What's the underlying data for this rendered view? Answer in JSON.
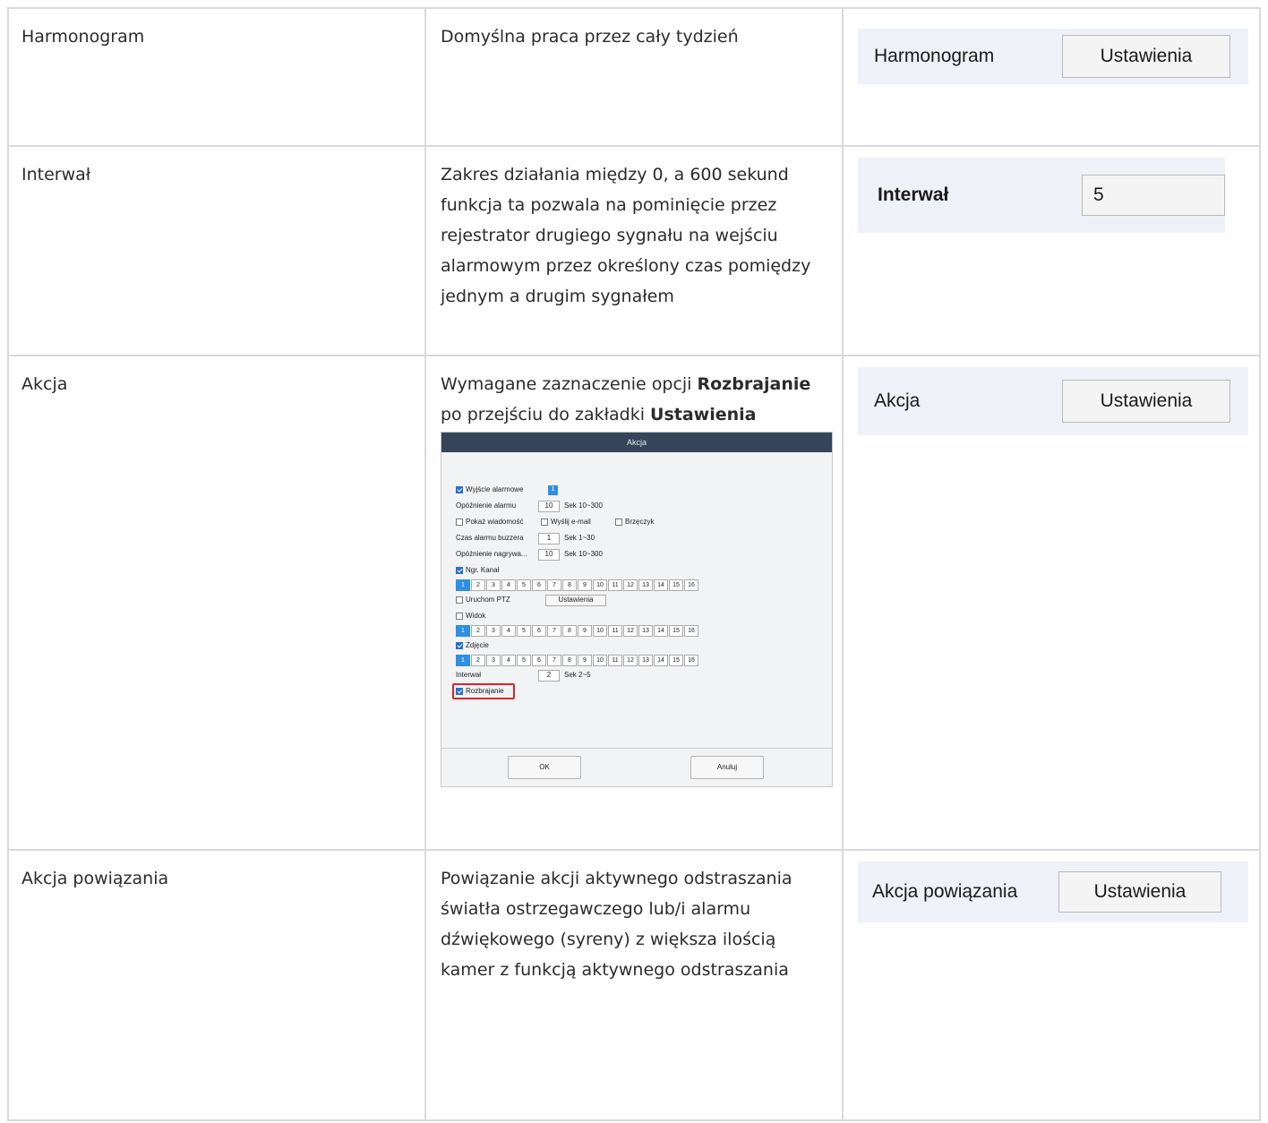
{
  "rows": [
    {
      "param": "Harmonogram",
      "desc": "Domyślna praca przez cały tydzień",
      "panel": {
        "label": "Harmonogram",
        "button": "Ustawienia"
      }
    },
    {
      "param": "Interwał",
      "desc": "Zakres działania między 0, a 600 sekund funkcja ta pozwala na pominięcie przez rejestrator drugiego sygnału na wejściu alarmowym przez określony czas pomiędzy jednym a drugim sygnałem",
      "panel": {
        "label": "Interwał",
        "input_value": "5"
      }
    },
    {
      "param": "Akcja",
      "desc_pre": "Wymagane zaznaczenie opcji ",
      "desc_b1": "Rozbrajanie",
      "desc_mid": " po przejściu do zakładki ",
      "desc_b2": "Ustawienia",
      "panel": {
        "label": "Akcja",
        "button": "Ustawienia"
      }
    },
    {
      "param": "Akcja powiązania",
      "desc": "Powiązanie akcji aktywnego odstraszania światła ostrzegawczego lub/i alarmu dźwiękowego (syreny) z większa ilością kamer z funkcją aktywnego odstraszania",
      "panel": {
        "label": "Akcja powiązania",
        "button": "Ustawienia"
      }
    }
  ],
  "dialog": {
    "title": "Akcja",
    "alarm_output": "Wyjście alarmowe",
    "alarm_output_num": "1",
    "alarm_delay": "Opóźnienie alarmu",
    "alarm_delay_val": "10",
    "alarm_delay_range": "Sek  10~300",
    "show_msg": "Pokaż wiadomość",
    "send_email": "Wyślij e-mail",
    "buzzer": "Brzęczyk",
    "buzzer_time": "Czas alarmu buzzera",
    "buzzer_time_val": "1",
    "buzzer_time_range": "Sek  1~30",
    "rec_delay": "Opóźnienie nagrywa...",
    "rec_delay_val": "10",
    "rec_delay_range": "Sek  10~300",
    "rec_channel": "Ngr. Kanał",
    "ptz": "Uruchom PTZ",
    "ptz_btn": "Ustawienia",
    "view": "Widok",
    "snapshot": "Zdjęcie",
    "interval": "Interwał",
    "interval_val": "2",
    "interval_range": "Sek  2~5",
    "disarm": "Rozbrajanie",
    "ok": "OK",
    "cancel": "Anuluj",
    "channels": [
      "1",
      "2",
      "3",
      "4",
      "5",
      "6",
      "7",
      "8",
      "9",
      "10",
      "11",
      "12",
      "13",
      "14",
      "15",
      "16"
    ]
  }
}
